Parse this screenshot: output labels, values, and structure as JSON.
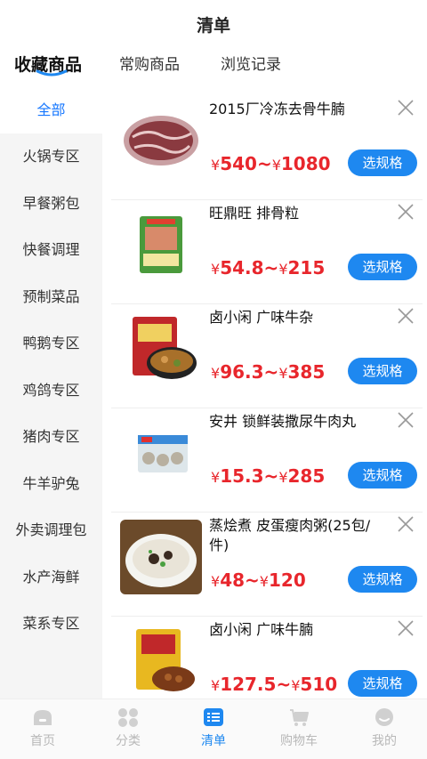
{
  "header": {
    "title": "清单"
  },
  "tabs": [
    {
      "label": "收藏商品",
      "active": true
    },
    {
      "label": "常购商品",
      "active": false
    },
    {
      "label": "浏览记录",
      "active": false
    }
  ],
  "sidebar": {
    "items": [
      {
        "label": "全部",
        "active": true
      },
      {
        "label": "火锅专区"
      },
      {
        "label": "早餐粥包"
      },
      {
        "label": "快餐调理"
      },
      {
        "label": "预制菜品"
      },
      {
        "label": "鸭鹅专区"
      },
      {
        "label": "鸡鸽专区"
      },
      {
        "label": "猪肉专区"
      },
      {
        "label": "牛羊驴兔"
      },
      {
        "label": "外卖调理包"
      },
      {
        "label": "水产海鲜"
      },
      {
        "label": "菜系专区"
      }
    ]
  },
  "products": [
    {
      "name": "2015厂冷冻去骨牛腩",
      "price_low": "540",
      "price_high": "1080",
      "button": "选规格",
      "thumb": "frozen-beef-brisket"
    },
    {
      "name": "旺鼎旺 排骨粒",
      "price_low": "54.8",
      "price_high": "215",
      "button": "选规格",
      "thumb": "pork-rib-bag"
    },
    {
      "name": "卤小闲 广味牛杂",
      "price_low": "96.3",
      "price_high": "385",
      "button": "选规格",
      "thumb": "beef-offal-bag"
    },
    {
      "name": "安井 锁鲜装撒尿牛肉丸",
      "price_low": "15.3",
      "price_high": "285",
      "button": "选规格",
      "thumb": "beef-ball-pack"
    },
    {
      "name": "蒸烩煮 皮蛋瘦肉粥(25包/件)",
      "price_low": "48",
      "price_high": "120",
      "button": "选规格",
      "thumb": "congee-bowl"
    },
    {
      "name": "卤小闲 广味牛腩",
      "price_low": "127.5",
      "price_high": "510",
      "button": "选规格",
      "thumb": "beef-brisket-bag"
    }
  ],
  "currency": "¥",
  "tabbar": [
    {
      "label": "首页",
      "icon": "home-icon"
    },
    {
      "label": "分类",
      "icon": "category-icon"
    },
    {
      "label": "清单",
      "icon": "list-icon",
      "active": true
    },
    {
      "label": "购物车",
      "icon": "cart-icon"
    },
    {
      "label": "我的",
      "icon": "profile-icon"
    }
  ],
  "colors": {
    "accent": "#1e88f0",
    "price": "#e8262c",
    "sidebar_bg": "#f5f5f5"
  }
}
